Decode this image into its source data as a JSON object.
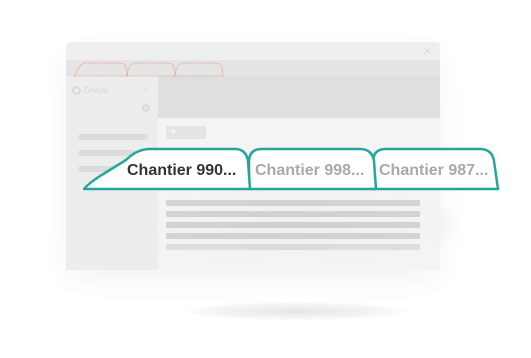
{
  "app": {
    "logo_text": "Onaya",
    "close_icon": "close-icon",
    "collapse_icon": "chevron-left-icon",
    "gear_icon": "gear-icon",
    "add_icon": "plus-icon"
  },
  "tabs": [
    {
      "label": "Chantier 990...",
      "state": "active"
    },
    {
      "label": "Chantier 998...",
      "state": "inactive"
    },
    {
      "label": "Chantier 987...",
      "state": "inactive"
    }
  ],
  "colors": {
    "tab_outline": "#26a69a",
    "mini_tab_outline": "#e8a080",
    "active_text": "#333333",
    "inactive_text": "#a9a9a9"
  }
}
